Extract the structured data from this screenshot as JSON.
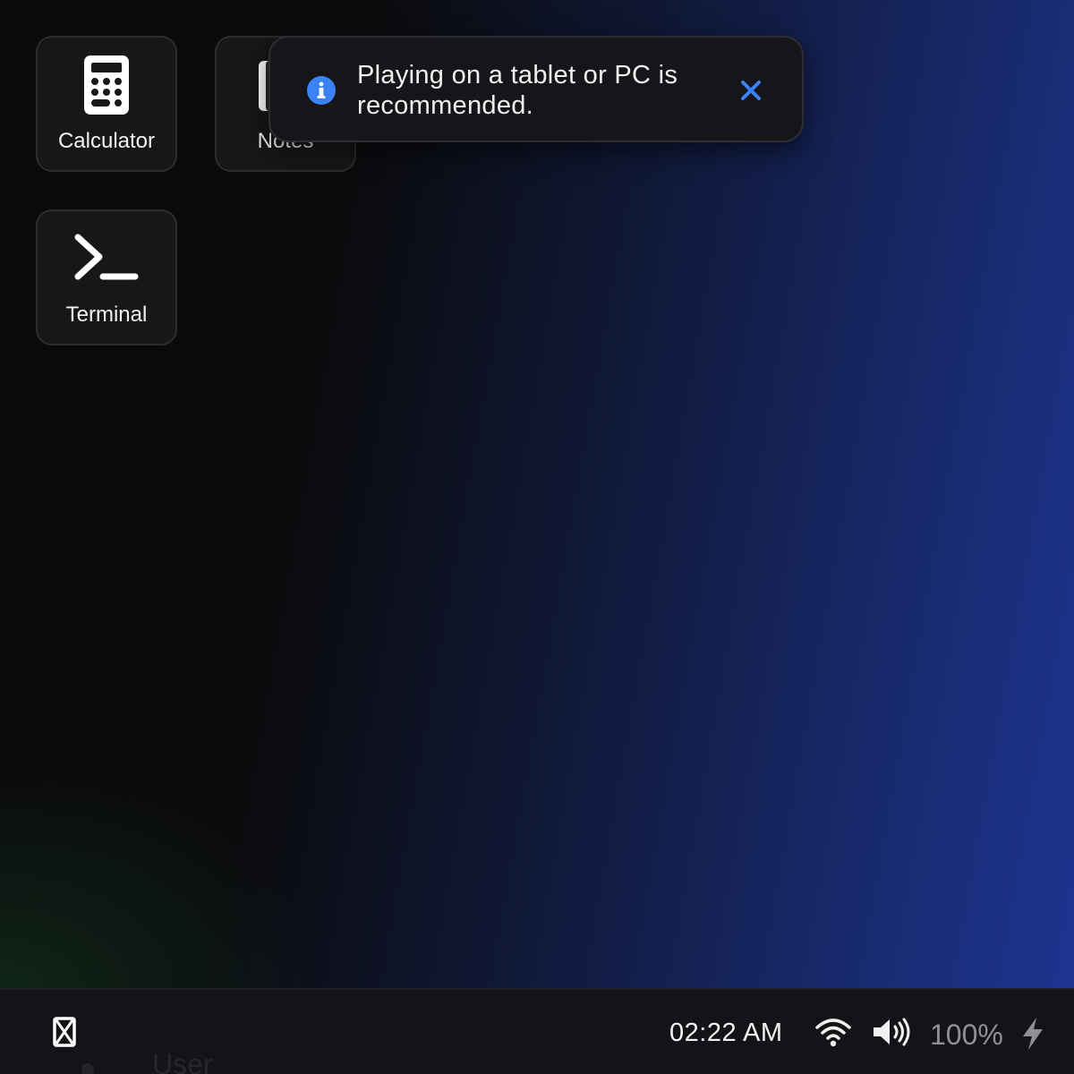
{
  "desktop": {
    "apps": [
      {
        "label": "Calculator",
        "icon": "calculator-icon"
      },
      {
        "label": "Notes",
        "icon": "notes-icon"
      },
      {
        "label": "Terminal",
        "icon": "terminal-icon"
      }
    ]
  },
  "notification": {
    "icon": "info-icon",
    "message": "Playing on a tablet or PC is recommended.",
    "close_icon": "close-icon",
    "accent_color": "#3b82f6"
  },
  "taskbar": {
    "start_icon": "hourglass-icon",
    "ghost_user_label": "User",
    "clock": "02:22 AM",
    "wifi_icon": "wifi-icon",
    "volume_icon": "volume-icon",
    "battery": "100%",
    "charging_icon": "lightning-bolt-icon"
  }
}
